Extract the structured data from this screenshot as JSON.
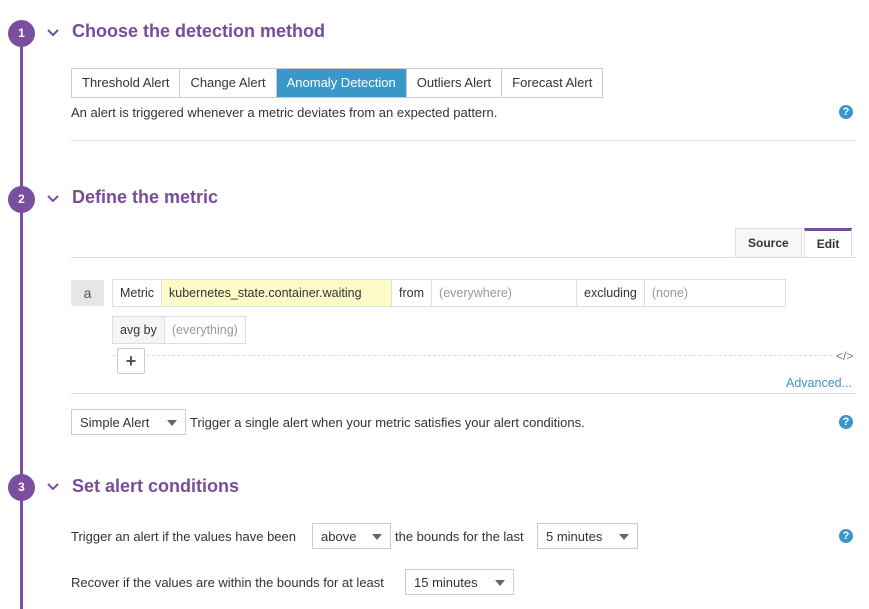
{
  "steps": {
    "s1": {
      "number": "1",
      "title": "Choose the detection method"
    },
    "s2": {
      "number": "2",
      "title": "Define the metric"
    },
    "s3": {
      "number": "3",
      "title": "Set alert conditions"
    }
  },
  "detection": {
    "tabs": [
      "Threshold Alert",
      "Change Alert",
      "Anomaly Detection",
      "Outliers Alert",
      "Forecast Alert"
    ],
    "active_tab": "Anomaly Detection",
    "description": "An alert is triggered whenever a metric deviates from an expected pattern."
  },
  "metric": {
    "source_tab": "Source",
    "edit_tab": "Edit",
    "query_letter": "a",
    "metric_label": "Metric",
    "metric_value": "kubernetes_state.container.waiting",
    "from_label": "from",
    "from_placeholder": "(everywhere)",
    "excluding_label": "excluding",
    "excluding_placeholder": "(none)",
    "avg_by_label": "avg by",
    "avg_by_placeholder": "(everything)",
    "add_symbol": "+",
    "code_symbol": "</>",
    "advanced_link": "Advanced..."
  },
  "alert_type": {
    "selected": "Simple Alert",
    "description": "Trigger a single alert when your metric satisfies your alert conditions."
  },
  "conditions": {
    "trigger_prefix": "Trigger an alert if the values have been",
    "direction_value": "above",
    "trigger_middle": "the bounds for the last",
    "window_value": "5 minutes",
    "recover_prefix": "Recover if the values are within the bounds for at least",
    "recover_value": "15 minutes"
  },
  "help_symbol": "?",
  "colors": {
    "accent": "#774d9b",
    "active_tab": "#3a97c9",
    "metric_highlight": "#fdfbc8"
  }
}
